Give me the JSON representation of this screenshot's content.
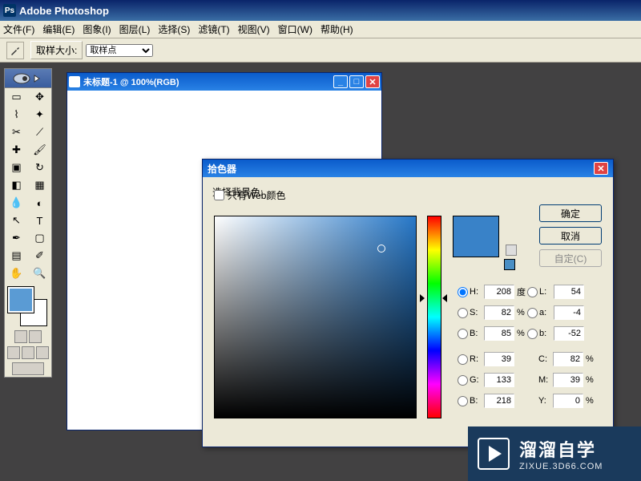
{
  "app": {
    "title": "Adobe Photoshop"
  },
  "menu": {
    "items": [
      "文件(F)",
      "编辑(E)",
      "图象(I)",
      "图层(L)",
      "选择(S)",
      "滤镜(T)",
      "视图(V)",
      "窗口(W)",
      "帮助(H)"
    ]
  },
  "options": {
    "sample_label": "取样大小:",
    "sample_value": "取样点"
  },
  "document": {
    "title": "未标题-1 @ 100%(RGB)"
  },
  "picker": {
    "title": "拾色器",
    "select_label": "选择背景色:",
    "ok": "确定",
    "cancel": "取消",
    "custom": "自定(C)",
    "webonly": "只有Web颜色",
    "h": {
      "label": "H:",
      "value": "208",
      "unit": "度"
    },
    "s": {
      "label": "S:",
      "value": "82",
      "unit": "%"
    },
    "b": {
      "label": "B:",
      "value": "85",
      "unit": "%"
    },
    "r": {
      "label": "R:",
      "value": "39"
    },
    "g": {
      "label": "G:",
      "value": "133"
    },
    "bl": {
      "label": "B:",
      "value": "218"
    },
    "L": {
      "label": "L:",
      "value": "54"
    },
    "a": {
      "label": "a:",
      "value": "-4"
    },
    "lab_b": {
      "label": "b:",
      "value": "-52"
    },
    "C": {
      "label": "C:",
      "value": "82",
      "unit": "%"
    },
    "M": {
      "label": "M:",
      "value": "39",
      "unit": "%"
    },
    "Y": {
      "label": "Y:",
      "value": "0",
      "unit": "%"
    }
  },
  "watermark": {
    "brand": "溜溜自学",
    "url": "ZIXUE.3D66.COM"
  }
}
